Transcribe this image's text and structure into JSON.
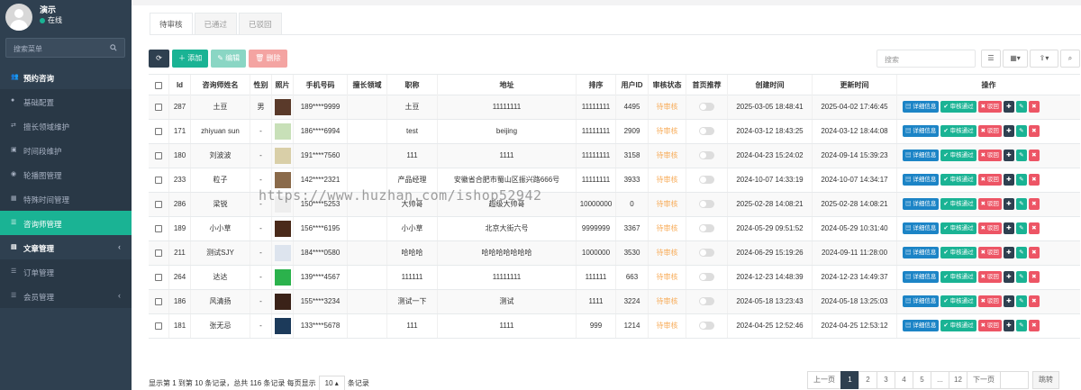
{
  "user": {
    "name": "演示",
    "status": "在线"
  },
  "sidebar": {
    "search_placeholder": "搜索菜单",
    "items": [
      {
        "label": "预约咨询",
        "type": "parent",
        "icon": "users-icon"
      },
      {
        "label": "基础配置",
        "type": "sub",
        "icon": "pin-icon"
      },
      {
        "label": "擅长领域维护",
        "type": "sub",
        "icon": "share-icon"
      },
      {
        "label": "时间段维护",
        "type": "sub",
        "icon": "image-icon"
      },
      {
        "label": "轮播图管理",
        "type": "sub",
        "icon": "palette-icon"
      },
      {
        "label": "特殊时间管理",
        "type": "sub",
        "icon": "calendar-icon"
      },
      {
        "label": "咨询师管理",
        "type": "active",
        "icon": "list-icon"
      },
      {
        "label": "文章管理",
        "type": "parent",
        "icon": "file-icon",
        "arrow": "‹"
      },
      {
        "label": "订单管理",
        "type": "sub",
        "icon": "list-icon"
      },
      {
        "label": "会员管理",
        "type": "sub",
        "icon": "list-icon",
        "arrow": "‹"
      }
    ]
  },
  "tabs": [
    "待审核",
    "已通过",
    "已驳回"
  ],
  "toolbar": {
    "add": "添加",
    "edit": "编辑",
    "delete": "删除"
  },
  "search": {
    "placeholder": "搜索"
  },
  "table": {
    "headers": [
      "Id",
      "咨询师姓名",
      "性别",
      "照片",
      "手机号码",
      "擅长领域",
      "职称",
      "地址",
      "排序",
      "用户ID",
      "审核状态",
      "首页推荐",
      "创建时间",
      "更新时间",
      "操作"
    ],
    "rows": [
      {
        "id": "287",
        "name": "土豆",
        "gender": "男",
        "phone": "189****9999",
        "field": "",
        "title": "土豆",
        "address": "11111111",
        "sort": "11111111",
        "uid": "4495",
        "status": "待审核",
        "created": "2025-03-05 18:48:41",
        "updated": "2025-04-02 17:46:45",
        "photo": "#5a3a2a"
      },
      {
        "id": "171",
        "name": "zhiyuan sun",
        "gender": "-",
        "phone": "186****6994",
        "field": "",
        "title": "test",
        "address": "beijing",
        "sort": "11111111",
        "uid": "2909",
        "status": "待审核",
        "created": "2024-03-12 18:43:25",
        "updated": "2024-03-12 18:44:08",
        "photo": "#c8e0b8"
      },
      {
        "id": "180",
        "name": "刘波波",
        "gender": "-",
        "phone": "191****7560",
        "field": "",
        "title": "111",
        "address": "1111",
        "sort": "11111111",
        "uid": "3158",
        "status": "待审核",
        "created": "2024-04-23 15:24:02",
        "updated": "2024-09-14 15:39:23",
        "photo": "#d9cfa8"
      },
      {
        "id": "233",
        "name": "粒子",
        "gender": "-",
        "phone": "142****2321",
        "field": "",
        "title": "产品经理",
        "address": "安徽省合肥市蜀山区振兴路666号",
        "sort": "11111111",
        "uid": "3933",
        "status": "待审核",
        "created": "2024-10-07 14:33:19",
        "updated": "2024-10-07 14:34:17",
        "photo": "#8a6a4a"
      },
      {
        "id": "286",
        "name": "梁锐",
        "gender": "-",
        "phone": "150****5253",
        "field": "",
        "title": "大帅哥",
        "address": "超级大帅哥",
        "sort": "10000000",
        "uid": "0",
        "status": "待审核",
        "created": "2025-02-28 14:08:21",
        "updated": "2025-02-28 14:08:21",
        "photo": "#eeeeee"
      },
      {
        "id": "189",
        "name": "小小草",
        "gender": "-",
        "phone": "156****6195",
        "field": "",
        "title": "小小草",
        "address": "北京大街六号",
        "sort": "9999999",
        "uid": "3367",
        "status": "待审核",
        "created": "2024-05-29 09:51:52",
        "updated": "2024-05-29 10:31:40",
        "photo": "#4a2a1a"
      },
      {
        "id": "211",
        "name": "测试SJY",
        "gender": "-",
        "phone": "184****0580",
        "field": "",
        "title": "哈哈哈",
        "address": "哈哈哈哈哈哈哈",
        "sort": "1000000",
        "uid": "3530",
        "status": "待审核",
        "created": "2024-06-29 15:19:26",
        "updated": "2024-09-11 11:28:00",
        "photo": "#dde4ee"
      },
      {
        "id": "264",
        "name": "达达",
        "gender": "-",
        "phone": "139****4567",
        "field": "",
        "title": "111111",
        "address": "11111111",
        "sort": "111111",
        "uid": "663",
        "status": "待审核",
        "created": "2024-12-23 14:48:39",
        "updated": "2024-12-23 14:49:37",
        "photo": "#2bb24c"
      },
      {
        "id": "186",
        "name": "风清扬",
        "gender": "-",
        "phone": "155****3234",
        "field": "",
        "title": "测试一下",
        "address": "测试",
        "sort": "1111",
        "uid": "3224",
        "status": "待审核",
        "created": "2024-05-18 13:23:43",
        "updated": "2024-05-18 13:25:03",
        "photo": "#3a2218"
      },
      {
        "id": "181",
        "name": "张无忌",
        "gender": "-",
        "phone": "133****5678",
        "field": "",
        "title": "111",
        "address": "1111",
        "sort": "999",
        "uid": "1214",
        "status": "待审核",
        "created": "2024-04-25 12:52:46",
        "updated": "2024-04-25 12:53:12",
        "photo": "#1c3a5a"
      }
    ]
  },
  "ops": {
    "detail": "详细信息",
    "pass": "审核通过",
    "reject": "驳回"
  },
  "footer": {
    "info_prefix": "显示第 1 到第 10 条记录，总共 116 条记录 每页显示",
    "page_size": "10",
    "info_suffix": "条记录"
  },
  "pager": {
    "prev": "上一页",
    "pages": [
      "1",
      "2",
      "3",
      "4",
      "5",
      "...",
      "12"
    ],
    "next": "下一页",
    "jump": "跳转"
  },
  "watermark": "https://www.huzhan.com/ishop52942"
}
